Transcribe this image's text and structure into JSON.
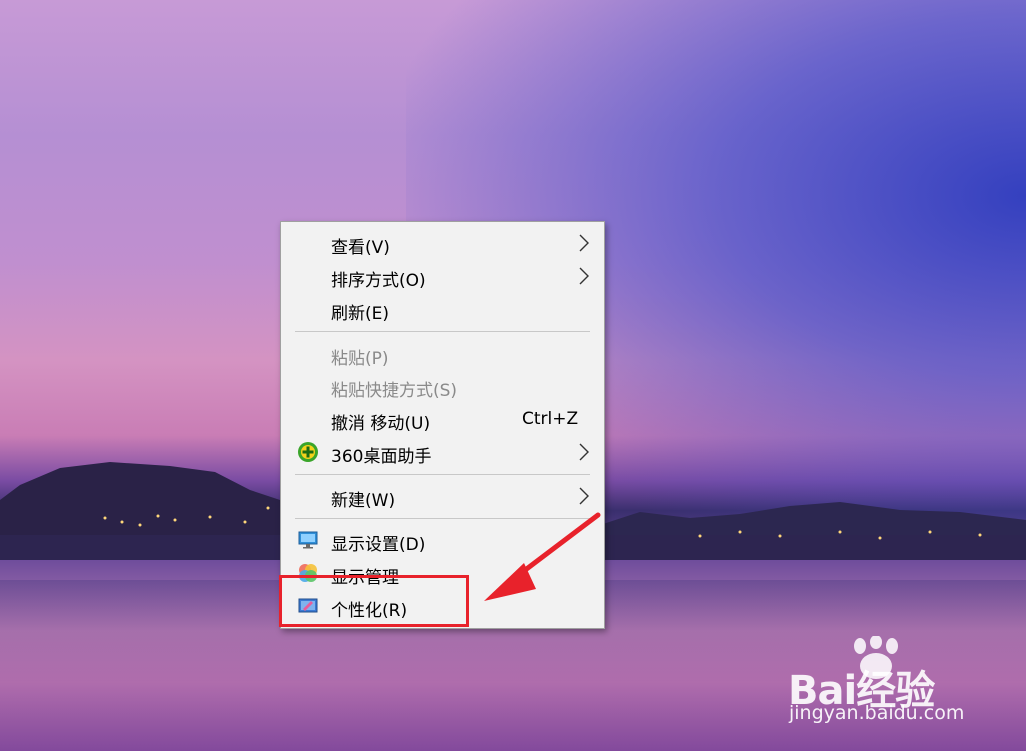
{
  "context_menu": {
    "items": [
      {
        "label": "查看(V)",
        "submenu": true,
        "enabled": true
      },
      {
        "label": "排序方式(O)",
        "submenu": true,
        "enabled": true
      },
      {
        "label": "刷新(E)",
        "submenu": false,
        "enabled": true
      },
      {
        "label": "粘贴(P)",
        "submenu": false,
        "enabled": false
      },
      {
        "label": "粘贴快捷方式(S)",
        "submenu": false,
        "enabled": false
      },
      {
        "label": "撤消 移动(U)",
        "shortcut": "Ctrl+Z",
        "submenu": false,
        "enabled": true
      },
      {
        "label": "360桌面助手",
        "submenu": true,
        "enabled": true,
        "icon": "360-plus-icon"
      },
      {
        "label": "新建(W)",
        "submenu": true,
        "enabled": true
      },
      {
        "label": "显示设置(D)",
        "submenu": false,
        "enabled": true,
        "icon": "display-settings-icon"
      },
      {
        "label": "显示管理",
        "submenu": false,
        "enabled": true,
        "icon": "display-manager-icon"
      },
      {
        "label": "个性化(R)",
        "submenu": false,
        "enabled": true,
        "icon": "personalize-icon"
      }
    ]
  },
  "annotation": {
    "highlight_target": "个性化(R)",
    "color": "#e8222b"
  },
  "watermark": {
    "logo_text": "Bai经验",
    "url": "jingyan.baidu.com"
  },
  "colors": {
    "menu_bg": "#f2f2f2",
    "disabled_text": "#8a8a8a"
  }
}
